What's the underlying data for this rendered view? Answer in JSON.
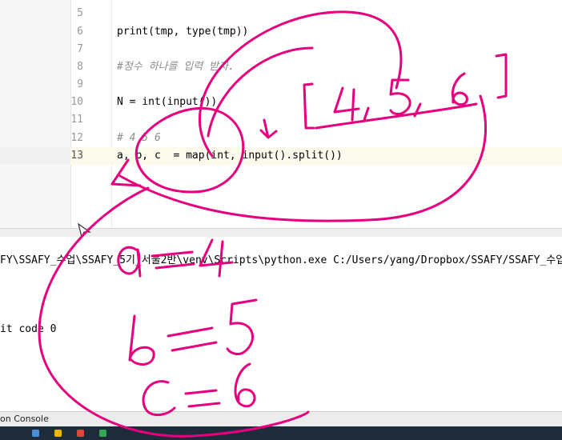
{
  "editor": {
    "lines": [
      {
        "num": "5",
        "text": "",
        "type": "code"
      },
      {
        "num": "6",
        "text": "print(tmp, type(tmp))",
        "type": "code"
      },
      {
        "num": "7",
        "text": "",
        "type": "code"
      },
      {
        "num": "8",
        "text": "#정수 하나를 입력 받자.",
        "type": "comment"
      },
      {
        "num": "9",
        "text": "",
        "type": "code"
      },
      {
        "num": "10",
        "text": "N = int(input())",
        "type": "code"
      },
      {
        "num": "11",
        "text": "",
        "type": "code"
      },
      {
        "num": "12",
        "text": "# 4 5 6",
        "type": "comment"
      },
      {
        "num": "13",
        "text": "a, b, c  = map(int, input().split())",
        "type": "code"
      }
    ]
  },
  "console": {
    "command": "FY\\SSAFY_수업\\SSAFY_5기_서울2반\\venv\\Scripts\\python.exe C:/Users/yang/Dropbox/SSAFY/SSAFY_수업/SS",
    "exit_text": "it code 0"
  },
  "bottom_tab": {
    "label": "on Console"
  },
  "annotations": {
    "list_text": "[4, 5, 6]",
    "a_eq": "a=4",
    "b_eq": "b=5",
    "c_eq": "c=6"
  },
  "colors": {
    "ink": "#e6007e",
    "comment": "#8c8c8c",
    "gutter": "#f7f7f7"
  }
}
